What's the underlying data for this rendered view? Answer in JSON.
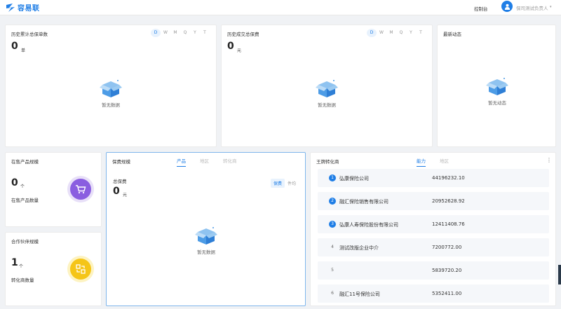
{
  "header": {
    "logo_text": "容易联",
    "console_label": "控制台",
    "username": "保司测试负责人",
    "caret": "▾"
  },
  "period_tabs": [
    "D",
    "W",
    "M",
    "Q",
    "Y",
    "T"
  ],
  "policy_count_card": {
    "title": "历史累计总保单数",
    "value": "0",
    "unit": "单",
    "empty_text": "暂无数据"
  },
  "premium_card": {
    "title": "历史成交总保费",
    "value": "0",
    "unit": "元",
    "empty_text": "暂无数据"
  },
  "news_card": {
    "title": "最新动态",
    "empty_text": "暂无动态"
  },
  "products_card": {
    "title": "在售产品规模",
    "value": "0",
    "unit": "个",
    "label": "在售产品数量"
  },
  "partners_card": {
    "title": "合作伙伴规模",
    "value": "1",
    "unit": "个",
    "label": "转化商数量"
  },
  "premium_scale_card": {
    "title": "保费规模",
    "tabs": [
      "产品",
      "地区",
      "转化商"
    ],
    "total_label": "总保费",
    "value": "0",
    "unit": "元",
    "segments": [
      "保费",
      "件均"
    ],
    "empty_text": "暂无数据"
  },
  "ranking_card": {
    "title": "王牌转化商",
    "tabs": [
      "能力",
      "地区"
    ],
    "menu_icon": "⋮",
    "rows": [
      {
        "rank": "1",
        "name": "弘康保险公司",
        "value": "44196232.10"
      },
      {
        "rank": "2",
        "name": "融汇保险销售有限公司",
        "value": "20952628.92"
      },
      {
        "rank": "3",
        "name": "弘康人寿保险股份有限公司",
        "value": "12411408.76"
      },
      {
        "rank": "4",
        "name": "测试改版企业中介",
        "value": "7200772.00"
      },
      {
        "rank": "5",
        "name": "",
        "value": "5839720.20"
      },
      {
        "rank": "6",
        "name": "融汇11号保险公司",
        "value": "5352411.00"
      }
    ]
  },
  "colors": {
    "accent": "#1f7ee6",
    "purple": "#8a5ee0",
    "yellow": "#f5c518"
  }
}
